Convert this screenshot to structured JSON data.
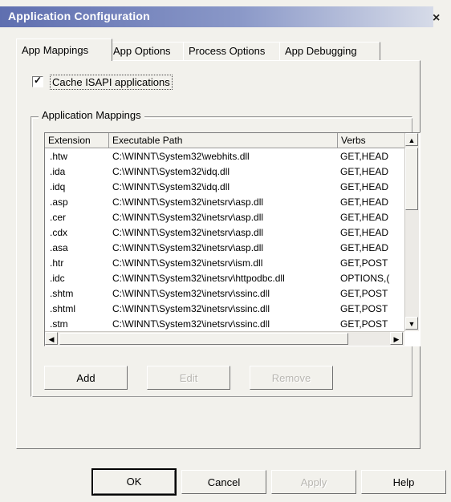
{
  "window": {
    "title": "Application Configuration",
    "close_glyph": "×"
  },
  "tabs": [
    {
      "label": "App Mappings",
      "active": true
    },
    {
      "label": "App Options",
      "active": false
    },
    {
      "label": "Process Options",
      "active": false
    },
    {
      "label": "App Debugging",
      "active": false
    }
  ],
  "cache_checkbox": {
    "label": "Cache ISAPI applications",
    "checked": true,
    "check_glyph": "✓"
  },
  "mappings_group": {
    "title": "Application Mappings",
    "columns": [
      "Extension",
      "Executable Path",
      "Verbs"
    ],
    "rows": [
      {
        "ext": ".htw",
        "path": "C:\\WINNT\\System32\\webhits.dll",
        "verbs": "GET,HEAD"
      },
      {
        "ext": ".ida",
        "path": "C:\\WINNT\\System32\\idq.dll",
        "verbs": "GET,HEAD"
      },
      {
        "ext": ".idq",
        "path": "C:\\WINNT\\System32\\idq.dll",
        "verbs": "GET,HEAD"
      },
      {
        "ext": ".asp",
        "path": "C:\\WINNT\\System32\\inetsrv\\asp.dll",
        "verbs": "GET,HEAD"
      },
      {
        "ext": ".cer",
        "path": "C:\\WINNT\\System32\\inetsrv\\asp.dll",
        "verbs": "GET,HEAD"
      },
      {
        "ext": ".cdx",
        "path": "C:\\WINNT\\System32\\inetsrv\\asp.dll",
        "verbs": "GET,HEAD"
      },
      {
        "ext": ".asa",
        "path": "C:\\WINNT\\System32\\inetsrv\\asp.dll",
        "verbs": "GET,HEAD"
      },
      {
        "ext": ".htr",
        "path": "C:\\WINNT\\System32\\inetsrv\\ism.dll",
        "verbs": "GET,POST"
      },
      {
        "ext": ".idc",
        "path": "C:\\WINNT\\System32\\inetsrv\\httpodbc.dll",
        "verbs": "OPTIONS,("
      },
      {
        "ext": ".shtm",
        "path": "C:\\WINNT\\System32\\inetsrv\\ssinc.dll",
        "verbs": "GET,POST"
      },
      {
        "ext": ".shtml",
        "path": "C:\\WINNT\\System32\\inetsrv\\ssinc.dll",
        "verbs": "GET,POST"
      },
      {
        "ext": ".stm",
        "path": "C:\\WINNT\\System32\\inetsrv\\ssinc.dll",
        "verbs": "GET,POST"
      }
    ],
    "scroll_up_glyph": "▲",
    "scroll_down_glyph": "▼",
    "scroll_left_glyph": "◀",
    "scroll_right_glyph": "▶"
  },
  "group_buttons": {
    "add": "Add",
    "edit": "Edit",
    "remove": "Remove"
  },
  "footer_buttons": {
    "ok": "OK",
    "cancel": "Cancel",
    "apply": "Apply",
    "help": "Help"
  }
}
